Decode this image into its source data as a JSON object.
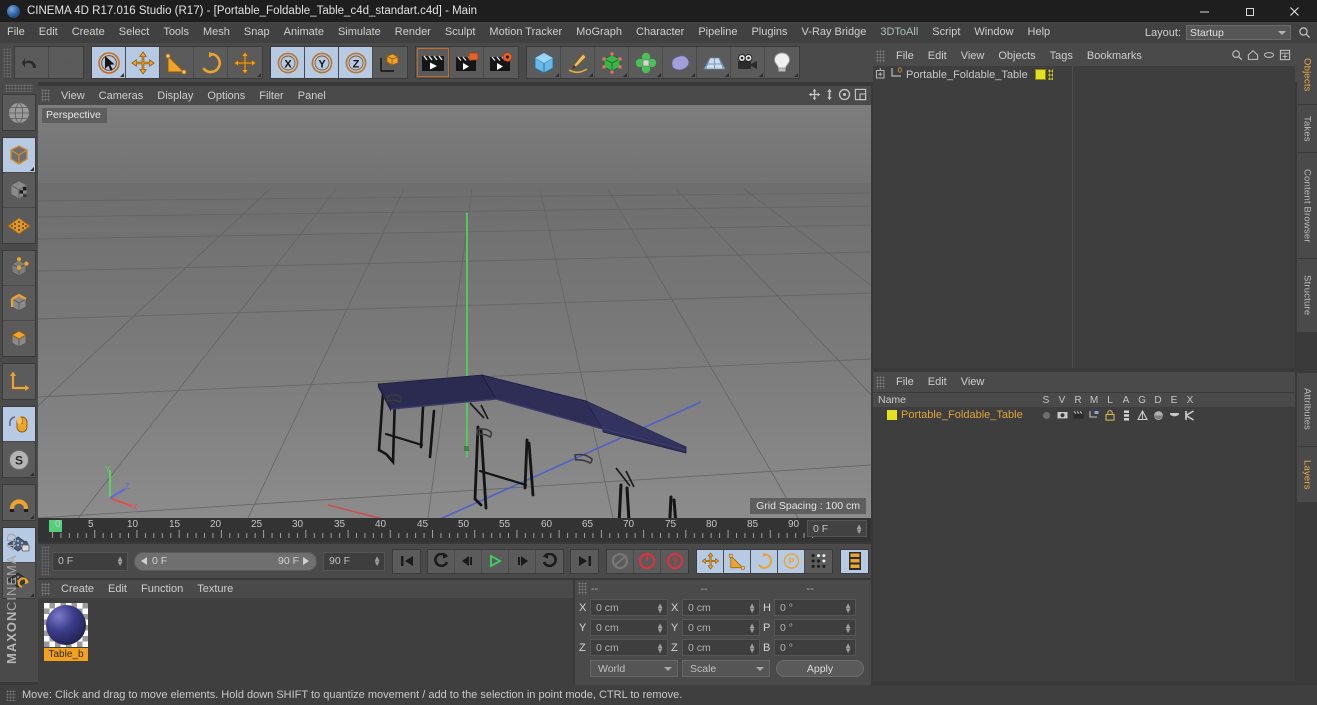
{
  "window": {
    "title": "CINEMA 4D R17.016 Studio (R17) - [Portable_Foldable_Table_c4d_standart.c4d] - Main",
    "minimize_label": "–",
    "maximize_label": "❐",
    "close_label": "✕"
  },
  "menubar": {
    "items": [
      "File",
      "Edit",
      "Create",
      "Select",
      "Tools",
      "Mesh",
      "Snap",
      "Animate",
      "Simulate",
      "Render",
      "Sculpt",
      "Motion Tracker",
      "MoGraph",
      "Character",
      "Pipeline",
      "Plugins",
      "V-Ray Bridge",
      "3DToAll",
      "Script",
      "Window",
      "Help"
    ],
    "layout_label": "Layout:",
    "layout_value": "Startup",
    "search_icon": "search-icon"
  },
  "toolbar": {
    "groups": [
      {
        "name": "history",
        "buttons": [
          {
            "name": "undo-button",
            "icon": "undo-arrow-icon",
            "state": "normal"
          },
          {
            "name": "redo-button",
            "icon": "redo-arrow-icon",
            "state": "disabled"
          }
        ]
      },
      {
        "name": "selection-transform",
        "buttons": [
          {
            "name": "live-selection-tool",
            "icon": "cursor-select-icon",
            "state": "selected"
          },
          {
            "name": "move-tool",
            "icon": "move-arrows-icon",
            "state": "selected"
          },
          {
            "name": "scale-tool",
            "icon": "scale-icon",
            "state": "normal"
          },
          {
            "name": "rotate-tool",
            "icon": "rotate-icon",
            "state": "normal"
          },
          {
            "name": "dynamic-place-tool",
            "icon": "move-arrows-icon",
            "state": "normal"
          }
        ]
      },
      {
        "name": "axis-locks",
        "buttons": [
          {
            "name": "x-axis-lock",
            "icon": "x-axis-icon",
            "state": "selected"
          },
          {
            "name": "y-axis-lock",
            "icon": "y-axis-icon",
            "state": "selected"
          },
          {
            "name": "z-axis-lock",
            "icon": "z-axis-icon",
            "state": "selected"
          },
          {
            "name": "world-object-coordinates",
            "icon": "coordinate-cube-icon",
            "state": "normal"
          }
        ]
      },
      {
        "name": "render",
        "buttons": [
          {
            "name": "render-view-button",
            "icon": "clapperboard-icon",
            "state": "normal"
          },
          {
            "name": "render-to-picture-viewer-button",
            "icon": "clapperboard-window-icon",
            "state": "normal"
          },
          {
            "name": "render-settings-button",
            "icon": "clapperboard-gear-icon",
            "state": "normal"
          }
        ]
      },
      {
        "name": "create-objects",
        "buttons": [
          {
            "name": "add-cube-button",
            "icon": "cube-icon",
            "state": "normal"
          },
          {
            "name": "add-spline-button",
            "icon": "pen-spline-icon",
            "state": "normal"
          },
          {
            "name": "add-generator-button",
            "icon": "green-cube-generator-icon",
            "state": "normal"
          },
          {
            "name": "add-deformer-button",
            "icon": "green-bend-deformer-icon",
            "state": "normal"
          },
          {
            "name": "add-environment-button",
            "icon": "sky-blob-icon",
            "state": "normal"
          },
          {
            "name": "add-floor-button",
            "icon": "floor-grid-icon",
            "state": "normal"
          },
          {
            "name": "add-camera-button",
            "icon": "camera-icon",
            "state": "normal"
          },
          {
            "name": "add-light-button",
            "icon": "light-bulb-icon",
            "state": "normal"
          }
        ]
      }
    ]
  },
  "left_palette": {
    "groups": [
      {
        "name": "modes-top",
        "buttons": [
          {
            "name": "make-editable-button",
            "icon": "sphere-to-polygon-icon",
            "state": "normal"
          }
        ]
      },
      {
        "name": "object-modes",
        "buttons": [
          {
            "name": "model-mode-button",
            "icon": "model-cube-icon",
            "state": "selected"
          },
          {
            "name": "texture-mode-button",
            "icon": "texture-checker-cube-icon",
            "state": "normal"
          },
          {
            "name": "workplane-mode-button",
            "icon": "workplane-grid-icon",
            "state": "normal"
          }
        ]
      },
      {
        "name": "component-modes",
        "buttons": [
          {
            "name": "points-mode-button",
            "icon": "points-cube-icon",
            "state": "normal"
          },
          {
            "name": "edges-mode-button",
            "icon": "edges-cube-icon",
            "state": "normal"
          },
          {
            "name": "polygons-mode-button",
            "icon": "polygons-cube-icon",
            "state": "normal"
          }
        ]
      },
      {
        "name": "axis-group",
        "buttons": [
          {
            "name": "enable-axis-modification-button",
            "icon": "axis-l-icon",
            "state": "normal"
          }
        ]
      },
      {
        "name": "selection-filters",
        "buttons": [
          {
            "name": "viewport-solo-single-button",
            "icon": "mouse-cursor-icon",
            "state": "selected"
          },
          {
            "name": "soft-selection-button",
            "icon": "s-circle-icon",
            "state": "selected"
          }
        ]
      },
      {
        "name": "snap-group",
        "buttons": [
          {
            "name": "enable-snapping-button",
            "icon": "magnet-icon",
            "state": "normal"
          }
        ]
      },
      {
        "name": "workplane-group",
        "buttons": [
          {
            "name": "lock-workplane-button",
            "icon": "workplane-lock-icon",
            "state": "selected"
          },
          {
            "name": "planar-workplane-button",
            "icon": "workplane-rotate-icon",
            "state": "normal"
          }
        ]
      }
    ],
    "brand_line1": "MAXON",
    "brand_line2": "CINEMA 4D"
  },
  "viewport": {
    "menus": [
      "View",
      "Cameras",
      "Display",
      "Options",
      "Filter",
      "Panel"
    ],
    "corner_icons": [
      "pan-view-icon",
      "zoom-view-icon",
      "rotate-view-icon",
      "maximize-view-icon"
    ],
    "label": "Perspective",
    "grid_spacing": "Grid Spacing : 100 cm",
    "axis_gizmo": {
      "x": "X",
      "y": "Y",
      "z": "Z"
    },
    "scene_object": "Portable_Foldable_Table"
  },
  "timeline": {
    "ticks": [
      "0",
      "5",
      "10",
      "15",
      "20",
      "25",
      "30",
      "35",
      "40",
      "45",
      "50",
      "55",
      "60",
      "65",
      "70",
      "75",
      "80",
      "85",
      "90"
    ],
    "current_frame_field": "0 F",
    "playhead_frame": "0"
  },
  "playback": {
    "current_frame": "0 F",
    "range_start": "0 F",
    "range_end": "90 F",
    "end_frame": "90 F",
    "buttons": [
      {
        "name": "go-to-start-button",
        "icon": "skip-start-icon",
        "state": "normal"
      },
      {
        "name": "go-to-previous-key-button",
        "icon": "previous-key-icon",
        "state": "normal"
      },
      {
        "name": "step-back-button",
        "icon": "step-back-icon",
        "state": "normal"
      },
      {
        "name": "play-button",
        "icon": "play-icon",
        "state": "normal"
      },
      {
        "name": "step-forward-button",
        "icon": "step-forward-icon",
        "state": "normal"
      },
      {
        "name": "go-to-next-key-button",
        "icon": "next-key-icon",
        "state": "normal"
      },
      {
        "name": "go-to-end-button",
        "icon": "skip-end-icon",
        "state": "normal"
      }
    ],
    "record_buttons": [
      {
        "name": "record-active-objects-button",
        "icon": "record-disabled-icon",
        "state": "disabled"
      },
      {
        "name": "autokeying-button",
        "icon": "autokey-icon",
        "state": "normal"
      },
      {
        "name": "keyframe-selection-button",
        "icon": "keyframe-question-icon",
        "state": "normal"
      }
    ],
    "key_toggles": [
      {
        "name": "position-key-toggle",
        "icon": "move-arrows-icon",
        "state": "selected"
      },
      {
        "name": "scale-key-toggle",
        "icon": "scale-icon",
        "state": "selected"
      },
      {
        "name": "rotation-key-toggle",
        "icon": "rotate-icon",
        "state": "selected"
      },
      {
        "name": "parameter-key-toggle",
        "icon": "p-circle-icon",
        "state": "selected"
      },
      {
        "name": "point-level-animation-toggle",
        "icon": "pla-dots-icon",
        "state": "normal"
      }
    ],
    "layers_button": {
      "name": "animation-layers-button",
      "icon": "layers-strip-icon",
      "state": "selected"
    }
  },
  "material_manager": {
    "menus": [
      "Create",
      "Edit",
      "Function",
      "Texture"
    ],
    "materials": [
      {
        "name": "Table_b",
        "icon": "material-sphere-preview"
      }
    ]
  },
  "coordinate_manager": {
    "column_headers": [
      "--",
      "--",
      "--"
    ],
    "position_rows": [
      {
        "label": "X",
        "value": "0 cm"
      },
      {
        "label": "Y",
        "value": "0 cm"
      },
      {
        "label": "Z",
        "value": "0 cm"
      }
    ],
    "size_rows": [
      {
        "label": "X",
        "value": "0 cm"
      },
      {
        "label": "Y",
        "value": "0 cm"
      },
      {
        "label": "Z",
        "value": "0 cm"
      }
    ],
    "rotation_rows": [
      {
        "label": "H",
        "value": "0 °"
      },
      {
        "label": "P",
        "value": "0 °"
      },
      {
        "label": "B",
        "value": "0 °"
      }
    ],
    "coord_system": "World",
    "size_mode": "Scale",
    "apply_label": "Apply"
  },
  "object_manager": {
    "menus": [
      "File",
      "Edit",
      "View",
      "Objects",
      "Tags",
      "Bookmarks"
    ],
    "header_icons": [
      "search-icon",
      "home-icon",
      "link-icon",
      "expand-icon"
    ],
    "rows": [
      {
        "name": "Portable_Foldable_Table",
        "expander": "plus-expander-icon",
        "layer_badge": "0",
        "tag_color": "#e5e01f"
      }
    ]
  },
  "layer_manager": {
    "menus": [
      "File",
      "Edit",
      "View"
    ],
    "columns": [
      "Name",
      "S",
      "V",
      "R",
      "M",
      "L",
      "A",
      "G",
      "D",
      "E",
      "X"
    ],
    "rows": [
      {
        "name": "Portable_Foldable_Table",
        "color": "#e5e01f",
        "icons": [
          "solo-dot-icon",
          "visible-icon",
          "render-icon",
          "manager-icon",
          "lock-icon",
          "animation-icon",
          "generators-icon",
          "deformers-icon",
          "expression-icon",
          "xref-icon"
        ]
      }
    ]
  },
  "right_tabs": {
    "top": [
      "Objects",
      "Takes",
      "Content Browser",
      "Structure"
    ],
    "bottom": [
      "Attributes",
      "Layers"
    ],
    "active_top": "Objects",
    "active_bottom": "Layers"
  },
  "statusbar": {
    "message": "Move: Click and drag to move elements. Hold down SHIFT to quantize movement / add to the selection in point mode, CTRL to remove."
  }
}
